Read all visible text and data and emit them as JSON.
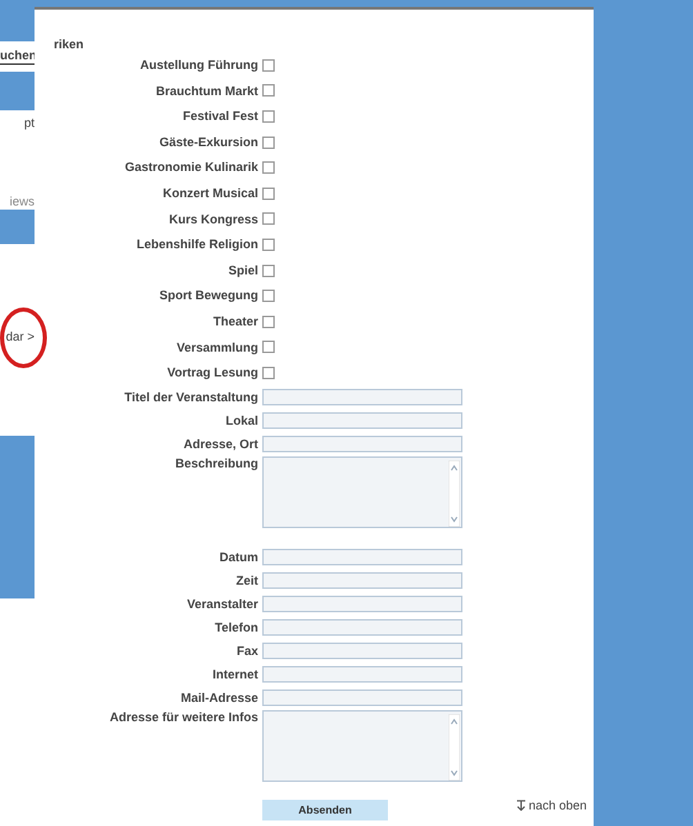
{
  "sidebar": {
    "items": [
      {
        "text": "uchen",
        "highlighted": false
      },
      {
        "text": "pt",
        "highlighted": false
      },
      {
        "text": "iews",
        "highlighted": false
      },
      {
        "text": "dar >",
        "highlighted": true
      }
    ]
  },
  "form": {
    "section_label": "riken",
    "categories": [
      {
        "label": "Austellung Führung",
        "checked": false
      },
      {
        "label": "Brauchtum Markt",
        "checked": false
      },
      {
        "label": "Festival Fest",
        "checked": false
      },
      {
        "label": "Gäste-Exkursion",
        "checked": false
      },
      {
        "label": "Gastronomie Kulinarik",
        "checked": false
      },
      {
        "label": "Konzert Musical",
        "checked": false
      },
      {
        "label": "Kurs Kongress",
        "checked": false
      },
      {
        "label": "Lebenshilfe Religion",
        "checked": false
      },
      {
        "label": "Spiel",
        "checked": false
      },
      {
        "label": "Sport Bewegung",
        "checked": false
      },
      {
        "label": "Theater",
        "checked": false
      },
      {
        "label": "Versammlung",
        "checked": false
      },
      {
        "label": "Vortrag Lesung",
        "checked": false
      }
    ],
    "fields": [
      {
        "label": "Titel der Veranstaltung",
        "kind": "input"
      },
      {
        "label": "Lokal",
        "kind": "input"
      },
      {
        "label": "Adresse, Ort",
        "kind": "input"
      },
      {
        "label": "Beschreibung",
        "kind": "textarea"
      },
      {
        "label": "Datum",
        "kind": "input"
      },
      {
        "label": "Zeit",
        "kind": "input"
      },
      {
        "label": "Veranstalter",
        "kind": "input"
      },
      {
        "label": "Telefon",
        "kind": "input"
      },
      {
        "label": "Fax",
        "kind": "input"
      },
      {
        "label": "Internet",
        "kind": "input"
      },
      {
        "label": "Mail-Adresse",
        "kind": "input"
      },
      {
        "label": "Adresse für weitere Infos",
        "kind": "textarea"
      }
    ],
    "submit": "Absenden"
  },
  "back_to_top": {
    "text": "nach oben"
  }
}
